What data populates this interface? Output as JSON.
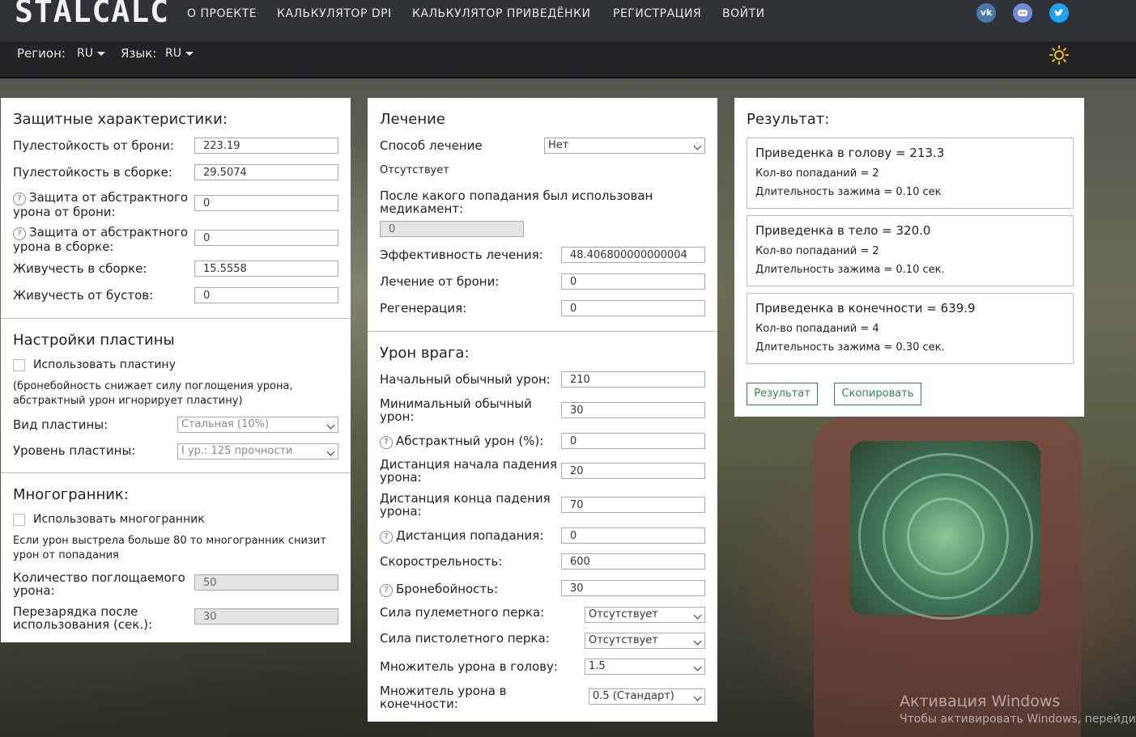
{
  "app": {
    "logo": "STALCALC"
  },
  "nav": [
    "О ПРОЕКТЕ",
    "КАЛЬКУЛЯТОР DPI",
    "КАЛЬКУЛЯТОР ПРИВЕДЁНКИ",
    "РЕГИСТРАЦИЯ",
    "ВОЙТИ"
  ],
  "social": [
    "vk-icon",
    "discord-icon",
    "twitter-icon"
  ],
  "subbar": {
    "region_label": "Регион:",
    "region_value": "RU",
    "lang_label": "Язык:",
    "lang_value": "RU",
    "theme_icon": "sun-icon"
  },
  "defense": {
    "title": "Защитные характеристики:",
    "armor_bullet_label": "Пулестойкость от брони:",
    "armor_bullet": "223.19",
    "build_bullet_label": "Пулестойкость в сборке:",
    "build_bullet": "29.5074",
    "armor_abstract_label": "Защита от абстрактного урона от брони:",
    "armor_abstract": "0",
    "build_abstract_label": "Защита от абстрактного урона в сборке:",
    "build_abstract": "0",
    "build_vitality_label": "Живучесть в сборке:",
    "build_vitality": "15.5558",
    "boost_vitality_label": "Живучесть от бустов:",
    "boost_vitality": "0"
  },
  "plate": {
    "title": "Настройки пластины",
    "use_label": "Использовать пластину",
    "note": "(бронебойность снижает силу поглощения урона, абстрактный урон игнорирует пластину)",
    "type_label": "Вид пластины:",
    "type_value": "Стальная (10%)",
    "level_label": "Уровень пластины:",
    "level_value": "I ур.: 125 прочности"
  },
  "poly": {
    "title": "Многогранник:",
    "use_label": "Использовать многогранник",
    "note": "Если урон выстрела больше 80 то многогранник снизит урон от попадания",
    "absorb_label": "Количество поглощаемого урона:",
    "absorb_value": "50",
    "reload_label": "Перезарядка после использования (сек.):",
    "reload_value": "30"
  },
  "heal": {
    "title": "Лечение",
    "method_label": "Способ лечение",
    "method_value": "Нет",
    "absent": "Отсутствует",
    "after_hit_label": "После какого попадания был использован медикамент:",
    "after_hit_value": "0",
    "eff_label": "Эффективность лечения:",
    "eff_value": "48.406800000000004",
    "armor_heal_label": "Лечение от брони:",
    "armor_heal_value": "0",
    "regen_label": "Регенерация:",
    "regen_value": "0"
  },
  "enemy": {
    "title": "Урон врага:",
    "init_dmg_label": "Начальный обычный урон:",
    "init_dmg": "210",
    "min_dmg_label": "Минимальный обычный урон:",
    "min_dmg": "30",
    "abstract_label": "Абстрактный урон (%):",
    "abstract": "0",
    "fall_start_label": "Дистанция начала падения урона:",
    "fall_start": "20",
    "fall_end_label": "Дистанция конца падения урона:",
    "fall_end": "70",
    "hit_dist_label": "Дистанция попадания:",
    "hit_dist": "0",
    "rate_label": "Скорострельность:",
    "rate": "600",
    "pen_label": "Бронебойность:",
    "pen": "30",
    "mg_perk_label": "Сила пулеметного перка:",
    "mg_perk": "Отсутствует",
    "pistol_perk_label": "Сила пистолетного перка:",
    "pistol_perk": "Отсутствует",
    "head_mult_label": "Множитель урона в голову:",
    "head_mult": "1.5",
    "limb_mult_label": "Множитель урона в конечности:",
    "limb_mult": "0.5 (Стандарт)"
  },
  "result": {
    "title": "Результат:",
    "head_title": "Приведенка в голову = 213.3",
    "head_hits": "Кол-во попаданий = 2",
    "head_hold": "Длительность зажима = 0.10 сек",
    "body_title": "Приведенка в тело = 320.0",
    "body_hits": "Кол-во попаданий = 2",
    "body_hold": "Длительность зажима = 0.10 сек.",
    "limb_title": "Приведенка в конечности = 639.9",
    "limb_hits": "Кол-во попаданий = 4",
    "limb_hold": "Длительность зажима = 0.30 сек.",
    "btn_result": "Результат",
    "btn_copy": "Скопировать"
  },
  "watermark": {
    "line1": "Активация Windows",
    "line2": "Чтобы активировать Windows, перейдите"
  }
}
